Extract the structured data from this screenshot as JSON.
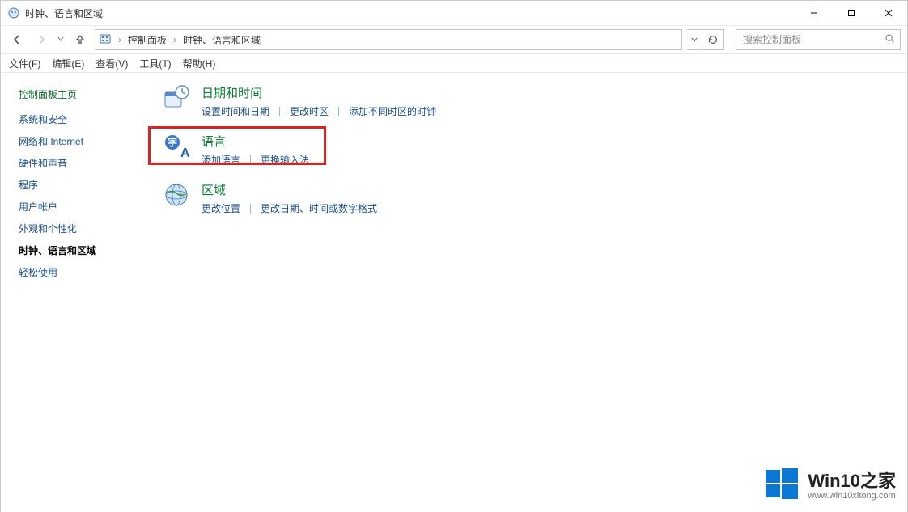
{
  "window": {
    "title": "时钟、语言和区域"
  },
  "breadcrumb": {
    "root": "控制面板",
    "current": "时钟、语言和区域"
  },
  "search": {
    "placeholder": "搜索控制面板"
  },
  "menu": {
    "file": "文件(F)",
    "edit": "编辑(E)",
    "view": "查看(V)",
    "tools": "工具(T)",
    "help": "帮助(H)"
  },
  "sidebar": {
    "home": "控制面板主页",
    "items": [
      {
        "label": "系统和安全"
      },
      {
        "label": "网络和 Internet"
      },
      {
        "label": "硬件和声音"
      },
      {
        "label": "程序"
      },
      {
        "label": "用户帐户"
      },
      {
        "label": "外观和个性化"
      },
      {
        "label": "时钟、语言和区域",
        "active": true
      },
      {
        "label": "轻松使用"
      }
    ]
  },
  "categories": {
    "datetime": {
      "title": "日期和时间",
      "links": [
        "设置时间和日期",
        "更改时区",
        "添加不同时区的时钟"
      ]
    },
    "language": {
      "title": "语言",
      "links": [
        "添加语言",
        "更换输入法"
      ]
    },
    "region": {
      "title": "区域",
      "links": [
        "更改位置",
        "更改日期、时间或数字格式"
      ]
    }
  },
  "watermark": {
    "main": "Win10之家",
    "sub": "www.win10xitong.com"
  }
}
